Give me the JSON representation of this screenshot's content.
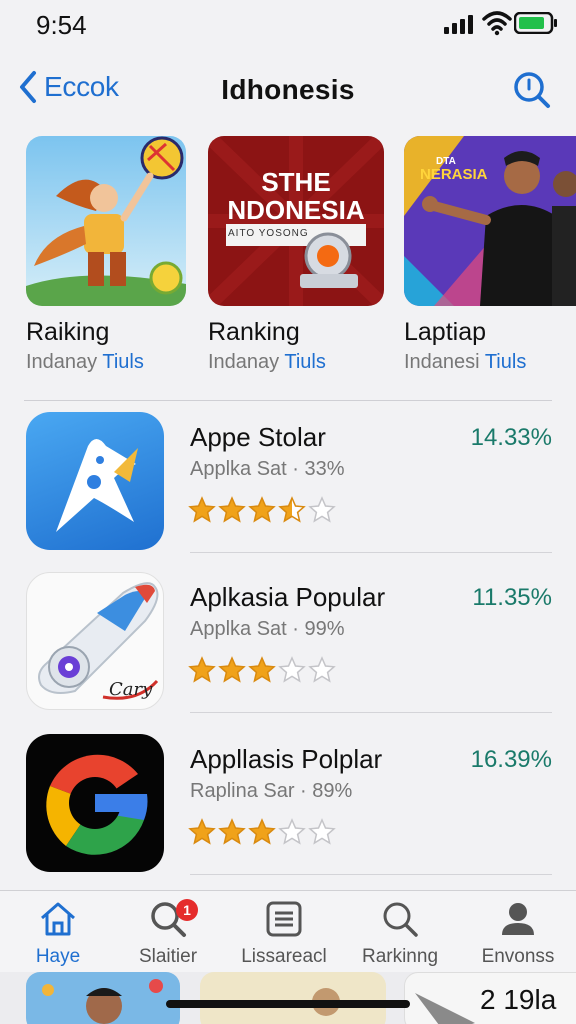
{
  "status_bar": {
    "time": "9:54"
  },
  "nav": {
    "back_label": "Eccok",
    "title": "Idhonesis"
  },
  "featured": [
    {
      "title": "Raiking",
      "sub_gray": "Indanay",
      "sub_blue": "Tiuls"
    },
    {
      "title": "Ranking",
      "sub_gray": "Indanay",
      "sub_blue": "Tiuls",
      "art_title_1": "STHE",
      "art_title_2": "NDONESIA",
      "art_banner": "AITO YOSONG"
    },
    {
      "title": "Laptiap",
      "sub_gray": "Indanesi",
      "sub_blue": "Tiuls",
      "art_small": "DTA",
      "art_title": "NERASIA"
    }
  ],
  "apps": [
    {
      "name": "Appe Stolar",
      "subtitle": "Applka Sat · 33%",
      "percent": "14.33%",
      "rating": 3.5,
      "icon": "paper-plane-icon",
      "color": "#2f8fe8"
    },
    {
      "name": "Aplkasia Popular",
      "subtitle": "Applka Sat · 99%",
      "percent": "11.35%",
      "rating": 3,
      "icon": "rocket-camera-icon",
      "color": "#ffffff",
      "icon_text": "Cary"
    },
    {
      "name": "Appllasis Polplar",
      "subtitle": "Raplina Sar · 89%",
      "percent": "16.39%",
      "rating": 3,
      "icon": "google-g-icon",
      "color": "#000000"
    }
  ],
  "tabs": [
    {
      "label": "Haye",
      "icon": "home-icon",
      "active": true
    },
    {
      "label": "Slaitier",
      "icon": "search-icon",
      "badge": "1"
    },
    {
      "label": "Lissareacl",
      "icon": "list-icon"
    },
    {
      "label": "Rarkinng",
      "icon": "search-icon"
    },
    {
      "label": "Envonss",
      "icon": "person-icon"
    }
  ],
  "peek": {
    "text": "2 19la"
  },
  "colors": {
    "accent": "#1f6fd0",
    "percent": "#1a7a6a",
    "star": "#f0a21a"
  }
}
